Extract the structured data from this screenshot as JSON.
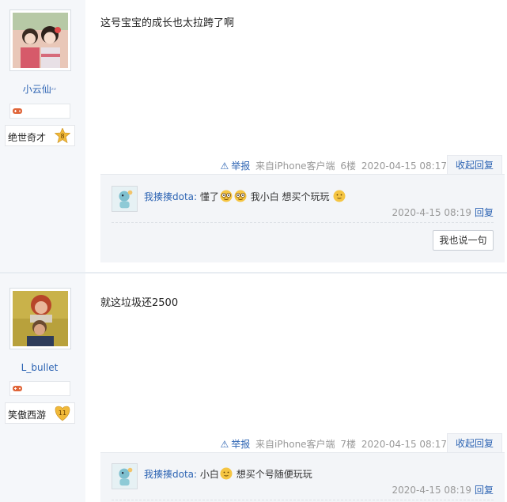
{
  "posts": [
    {
      "user": {
        "name": "小云仙",
        "title": "绝世奇才",
        "level": "8"
      },
      "content": "这号宝宝的成长也太拉跨了啊",
      "meta": {
        "report": "举报",
        "source": "来自iPhone客户端",
        "floor": "6楼",
        "time": "2020-04-15 08:17"
      },
      "reply_tab": "收起回复",
      "replies": [
        {
          "user": "我揍揍dota:",
          "text_parts": [
            "懂了",
            "",
            "我小白 想买个玩玩",
            ""
          ],
          "time": "2020-4-15 08:19",
          "reply_label": "回复"
        }
      ],
      "say_button": "我也说一句"
    },
    {
      "user": {
        "name": "L_bullet",
        "title": "笑傲西游",
        "level": "11"
      },
      "content": "就这垃圾还2500",
      "meta": {
        "report": "举报",
        "source": "来自iPhone客户端",
        "floor": "7楼",
        "time": "2020-04-15 08:17"
      },
      "reply_tab": "收起回复",
      "replies": [
        {
          "user": "我揍揍dota:",
          "text_parts": [
            "小白",
            "想买个号随便玩玩"
          ],
          "time": "2020-4-15 08:19",
          "reply_label": "回复"
        }
      ]
    }
  ],
  "colors": {
    "link": "#2d64b3",
    "meta": "#999999",
    "sidebar": "#f5f7fa",
    "reply_bg": "#f3f5f8"
  }
}
